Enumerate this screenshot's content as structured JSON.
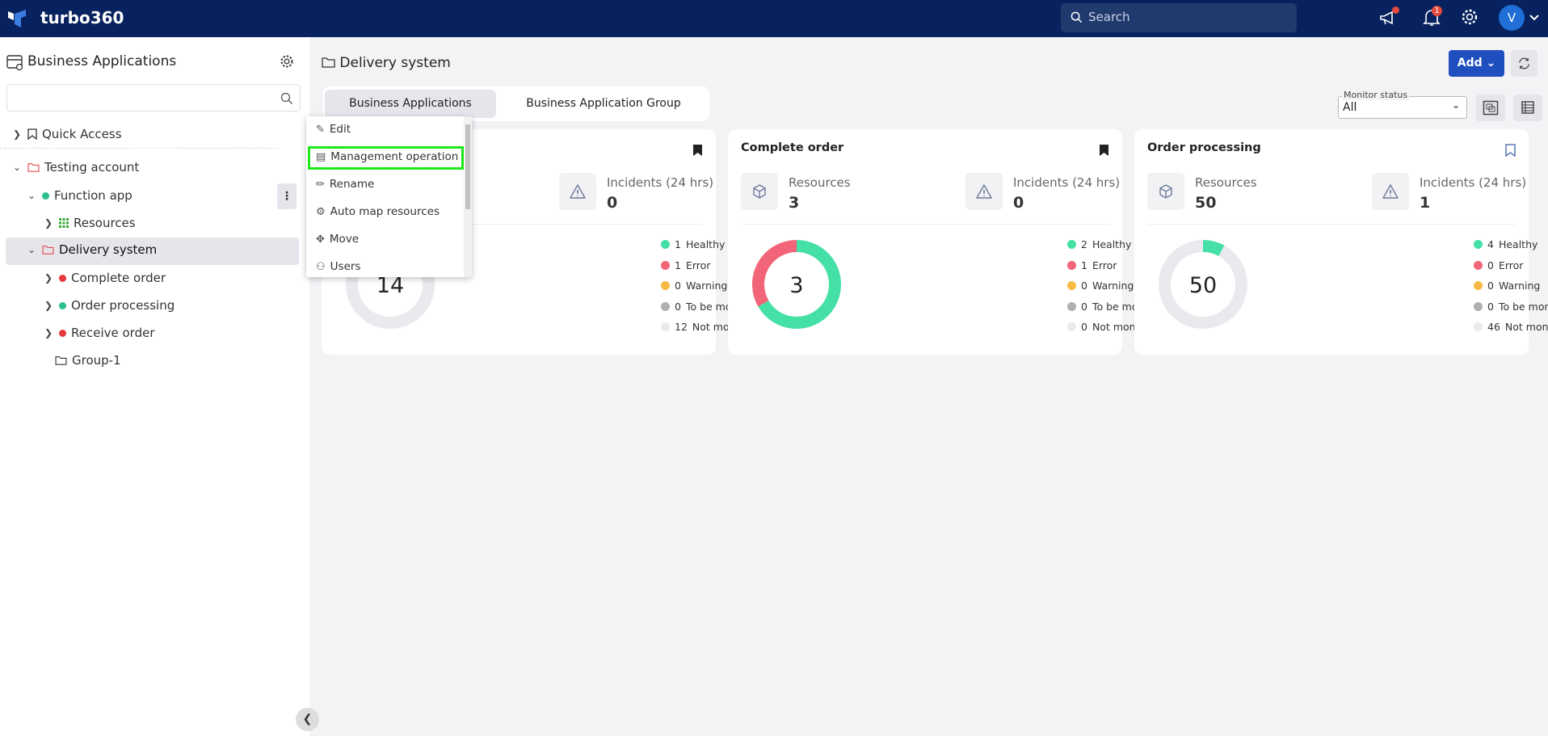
{
  "header": {
    "brand": "turbo360",
    "search_placeholder": "Search",
    "notification_count": "1",
    "avatar_initial": "V"
  },
  "sidebar": {
    "title": "Business Applications",
    "search_value": "",
    "quick_access": "Quick Access",
    "tree": [
      {
        "label": "Testing account",
        "status": "folder"
      },
      {
        "label": "Function app",
        "status": "healthy"
      },
      {
        "label": "Resources",
        "status": "resources"
      },
      {
        "label": "Delivery system",
        "status": "folder",
        "selected": true
      },
      {
        "label": "Complete order",
        "status": "error"
      },
      {
        "label": "Order processing",
        "status": "healthy"
      },
      {
        "label": "Receive order",
        "status": "error"
      },
      {
        "label": "Group-1",
        "status": "group"
      }
    ]
  },
  "context_menu": {
    "items": [
      "Edit",
      "Management operation",
      "Rename",
      "Auto map resources",
      "Move",
      "Users"
    ],
    "highlighted": "Management operation"
  },
  "main": {
    "title": "Delivery system",
    "tabs": [
      "Business Applications",
      "Business Application Group"
    ],
    "active_tab": "Business Applications",
    "add_label": "Add",
    "monitor_status_label": "Monitor status",
    "monitor_status_value": "All"
  },
  "colors": {
    "healthy": "#44e0a6",
    "error": "#f26477",
    "warning": "#f7bb45",
    "to_be_monitored": "#b0b0b0",
    "not_monitored": "#e9eaee",
    "accent": "#1f4fbf",
    "header": "#07225e"
  },
  "labels": {
    "resources": "Resources",
    "incidents": "Incidents (24 hrs)",
    "healthy": "Healthy",
    "error": "Error",
    "warning": "Warning",
    "to_be_monitored": "To be monitored",
    "not_monitored": "Not monitored"
  },
  "cards": [
    {
      "title": "",
      "bookmarked": true,
      "resources": "14",
      "incidents": "0",
      "total": "14",
      "healthy": 1,
      "error": 1,
      "warning": 0,
      "to_be_monitored": 0,
      "not_monitored": 12
    },
    {
      "title": "Complete order",
      "bookmarked": true,
      "resources": "3",
      "incidents": "0",
      "total": "3",
      "healthy": 2,
      "error": 1,
      "warning": 0,
      "to_be_monitored": 0,
      "not_monitored": 0
    },
    {
      "title": "Order processing",
      "bookmarked": false,
      "resources": "50",
      "incidents": "1",
      "total": "50",
      "healthy": 4,
      "error": 0,
      "warning": 0,
      "to_be_monitored": 0,
      "not_monitored": 46
    }
  ]
}
